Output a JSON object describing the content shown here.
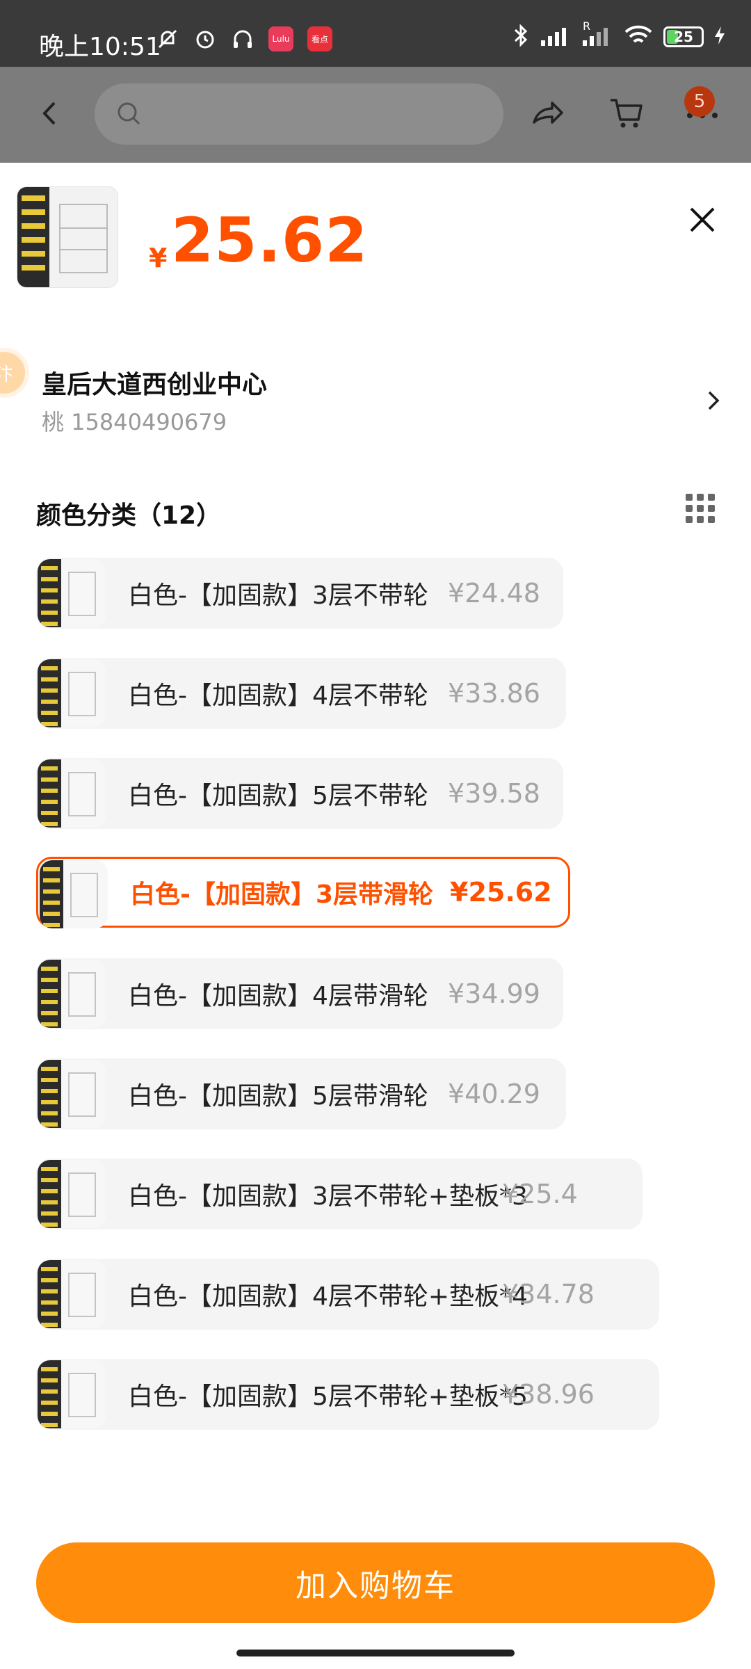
{
  "status_bar": {
    "time": "晚上10:51",
    "app1": "Lulu",
    "app2": "看点",
    "battery": "25",
    "signal_label": "R"
  },
  "top_nav": {
    "search_placeholder": "",
    "cart_badge": "5"
  },
  "product": {
    "currency_symbol": "¥",
    "price": "25.62"
  },
  "address": {
    "name": "皇后大道西创业中心",
    "contact": "桃 15840490679",
    "side_icon": "汴"
  },
  "section": {
    "title": "颜色分类（12）"
  },
  "options": [
    {
      "label": "白色-【加固款】3层不带轮",
      "price": "¥24.48",
      "selected": false
    },
    {
      "label": "白色-【加固款】4层不带轮",
      "price": "¥33.86",
      "selected": false
    },
    {
      "label": "白色-【加固款】5层不带轮",
      "price": "¥39.58",
      "selected": false
    },
    {
      "label": "白色-【加固款】3层带滑轮",
      "price": "¥25.62",
      "selected": true
    },
    {
      "label": "白色-【加固款】4层带滑轮",
      "price": "¥34.99",
      "selected": false
    },
    {
      "label": "白色-【加固款】5层带滑轮",
      "price": "¥40.29",
      "selected": false
    },
    {
      "label": "白色-【加固款】3层不带轮+垫板*3",
      "price": "¥25.4",
      "selected": false
    },
    {
      "label": "白色-【加固款】4层不带轮+垫板*4",
      "price": "¥34.78",
      "selected": false
    },
    {
      "label": "白色-【加固款】5层不带轮+垫板*5",
      "price": "¥38.96",
      "selected": false
    }
  ],
  "cta": {
    "label": "加入购物车"
  },
  "colors": {
    "accent": "#ff5000",
    "cta_bg": "#ff8c0a"
  }
}
